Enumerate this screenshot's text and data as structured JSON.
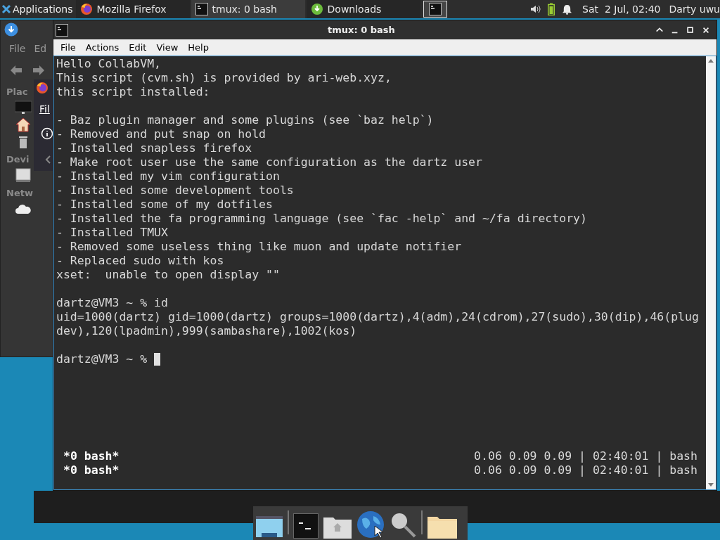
{
  "top_panel": {
    "apps_menu": "Applications",
    "tasks": [
      {
        "title": "Mozilla Firefox",
        "kind": "firefox",
        "selected": false
      },
      {
        "title": "tmux: 0 bash",
        "kind": "terminal",
        "selected": true
      },
      {
        "title": "Downloads",
        "kind": "download",
        "selected": false
      }
    ],
    "clock": "Sat  2 Jul, 02:40",
    "user": "Darty uwu"
  },
  "file_manager": {
    "menu": [
      "File",
      "Ed"
    ],
    "sections": [
      "Plac",
      "Devi",
      "Netw"
    ]
  },
  "firefox_window": {
    "menu": "Fil"
  },
  "terminal": {
    "title": "tmux: 0 bash",
    "menu": [
      "File",
      "Actions",
      "Edit",
      "View",
      "Help"
    ],
    "blocks": [
      [
        "Hello CollabVM,",
        "This script (cvm.sh) is provided by ari-web.xyz,",
        "this script installed:"
      ],
      [
        "- Baz plugin manager and some plugins (see `baz help`)",
        "- Removed and put snap on hold",
        "- Installed snapless firefox",
        "- Make root user use the same configuration as the dartz user",
        "- Installed my vim configuration",
        "- Installed some development tools",
        "- Installed some of my dotfiles",
        "- Installed the fa programming language (see `fac -help` and ~/fa directory)",
        "- Installed TMUX",
        "- Removed some useless thing like muon and update notifier",
        "- Replaced sudo with kos",
        "xset:  unable to open display \"\""
      ],
      [
        "dartz@VM3 ~ % id",
        "uid=1000(dartz) gid=1000(dartz) groups=1000(dartz),4(adm),24(cdrom),27(sudo),30(dip),46(plug",
        "dev),120(lpadmin),999(sambashare),1002(kos)"
      ]
    ],
    "prompt": "dartz@VM3 ~ %",
    "status_lines": [
      {
        "left": "*0 bash*",
        "right": "0.06 0.09 0.09 | 02:40:01 | bash"
      },
      {
        "left": "*0 bash*",
        "right": "0.06 0.09 0.09 | 02:40:01 | bash"
      }
    ]
  }
}
